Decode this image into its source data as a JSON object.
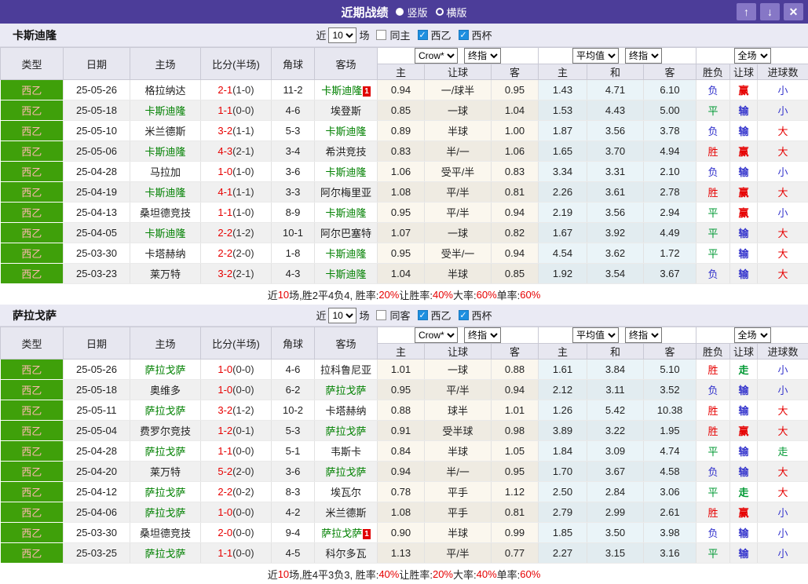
{
  "title_bar": {
    "title": "近期战绩",
    "radio_vertical": "竖版",
    "radio_horizontal": "横版",
    "up_button": "↑",
    "down_button": "↓",
    "close_button": "✕"
  },
  "controls": {
    "recent_label": "近",
    "matches_label": "场"
  },
  "selects": {
    "recent_count": "10",
    "odds_source": "Crow*",
    "final_odds": "终指",
    "average": "平均值",
    "scope": "全场"
  },
  "headers": {
    "type": "类型",
    "date": "日期",
    "home": "主场",
    "score": "比分(半场)",
    "corner": "角球",
    "away": "客场",
    "odds_home": "主",
    "odds_handicap": "让球",
    "odds_away": "客",
    "avg_home": "主",
    "avg_draw": "和",
    "avg_away": "客",
    "win_loss": "胜负",
    "handicap": "让球",
    "goals": "进球数"
  },
  "colors": {
    "titlebar_purple": "#4C3D99",
    "button_purple": "#8677C6",
    "league_green_bg": "#3FA00A",
    "self_team_green": "#008000",
    "score_red": "#E60000",
    "result_red": "#E60000",
    "result_blue": "#3333CC",
    "result_green": "#009933",
    "checkbox_blue": "#1E8FE0"
  },
  "sections": [
    {
      "team": "卡斯迪隆",
      "same_side_label": "同主",
      "same_side_checked": false,
      "league_label": "西乙",
      "league_checked": true,
      "cup_label": "西杯",
      "cup_checked": true,
      "rows": [
        {
          "league": "西乙",
          "date": "25-05-26",
          "home": "格拉纳达",
          "home_self": false,
          "home_badge": "",
          "score": "2-1",
          "half": "(1-0)",
          "corner": "11-2",
          "away": "卡斯迪隆",
          "away_self": true,
          "away_badge": "1",
          "odds_home": "0.94",
          "handicap": "一/球半",
          "odds_away": "0.95",
          "avg_home": "1.43",
          "avg_draw": "4.71",
          "avg_away": "6.10",
          "result": "负",
          "result_color": "blue",
          "handicap_result": "赢",
          "handicap_color": "red",
          "goals": "小",
          "goals_color": "blue"
        },
        {
          "league": "西乙",
          "date": "25-05-18",
          "home": "卡斯迪隆",
          "home_self": true,
          "home_badge": "",
          "score": "1-1",
          "half": "(0-0)",
          "corner": "4-6",
          "away": "埃登斯",
          "away_self": false,
          "away_badge": "",
          "odds_home": "0.85",
          "handicap": "一球",
          "odds_away": "1.04",
          "avg_home": "1.53",
          "avg_draw": "4.43",
          "avg_away": "5.00",
          "result": "平",
          "result_color": "green",
          "handicap_result": "输",
          "handicap_color": "blue",
          "goals": "小",
          "goals_color": "blue"
        },
        {
          "league": "西乙",
          "date": "25-05-10",
          "home": "米兰德斯",
          "home_self": false,
          "home_badge": "",
          "score": "3-2",
          "half": "(1-1)",
          "corner": "5-3",
          "away": "卡斯迪隆",
          "away_self": true,
          "away_badge": "",
          "odds_home": "0.89",
          "handicap": "半球",
          "odds_away": "1.00",
          "avg_home": "1.87",
          "avg_draw": "3.56",
          "avg_away": "3.78",
          "result": "负",
          "result_color": "blue",
          "handicap_result": "输",
          "handicap_color": "blue",
          "goals": "大",
          "goals_color": "red"
        },
        {
          "league": "西乙",
          "date": "25-05-06",
          "home": "卡斯迪隆",
          "home_self": true,
          "home_badge": "",
          "score": "4-3",
          "half": "(2-1)",
          "corner": "3-4",
          "away": "希洪竞技",
          "away_self": false,
          "away_badge": "",
          "odds_home": "0.83",
          "handicap": "半/一",
          "odds_away": "1.06",
          "avg_home": "1.65",
          "avg_draw": "3.70",
          "avg_away": "4.94",
          "result": "胜",
          "result_color": "red",
          "handicap_result": "赢",
          "handicap_color": "red",
          "goals": "大",
          "goals_color": "red"
        },
        {
          "league": "西乙",
          "date": "25-04-28",
          "home": "马拉加",
          "home_self": false,
          "home_badge": "",
          "score": "1-0",
          "half": "(1-0)",
          "corner": "3-6",
          "away": "卡斯迪隆",
          "away_self": true,
          "away_badge": "",
          "odds_home": "1.06",
          "handicap": "受平/半",
          "odds_away": "0.83",
          "avg_home": "3.34",
          "avg_draw": "3.31",
          "avg_away": "2.10",
          "result": "负",
          "result_color": "blue",
          "handicap_result": "输",
          "handicap_color": "blue",
          "goals": "小",
          "goals_color": "blue"
        },
        {
          "league": "西乙",
          "date": "25-04-19",
          "home": "卡斯迪隆",
          "home_self": true,
          "home_badge": "",
          "score": "4-1",
          "half": "(1-1)",
          "corner": "3-3",
          "away": "阿尔梅里亚",
          "away_self": false,
          "away_badge": "",
          "odds_home": "1.08",
          "handicap": "平/半",
          "odds_away": "0.81",
          "avg_home": "2.26",
          "avg_draw": "3.61",
          "avg_away": "2.78",
          "result": "胜",
          "result_color": "red",
          "handicap_result": "赢",
          "handicap_color": "red",
          "goals": "大",
          "goals_color": "red"
        },
        {
          "league": "西乙",
          "date": "25-04-13",
          "home": "桑坦德竞技",
          "home_self": false,
          "home_badge": "",
          "score": "1-1",
          "half": "(1-0)",
          "corner": "8-9",
          "away": "卡斯迪隆",
          "away_self": true,
          "away_badge": "",
          "odds_home": "0.95",
          "handicap": "平/半",
          "odds_away": "0.94",
          "avg_home": "2.19",
          "avg_draw": "3.56",
          "avg_away": "2.94",
          "result": "平",
          "result_color": "green",
          "handicap_result": "赢",
          "handicap_color": "red",
          "goals": "小",
          "goals_color": "blue"
        },
        {
          "league": "西乙",
          "date": "25-04-05",
          "home": "卡斯迪隆",
          "home_self": true,
          "home_badge": "",
          "score": "2-2",
          "half": "(1-2)",
          "corner": "10-1",
          "away": "阿尔巴塞特",
          "away_self": false,
          "away_badge": "",
          "odds_home": "1.07",
          "handicap": "一球",
          "odds_away": "0.82",
          "avg_home": "1.67",
          "avg_draw": "3.92",
          "avg_away": "4.49",
          "result": "平",
          "result_color": "green",
          "handicap_result": "输",
          "handicap_color": "blue",
          "goals": "大",
          "goals_color": "red"
        },
        {
          "league": "西乙",
          "date": "25-03-30",
          "home": "卡塔赫纳",
          "home_self": false,
          "home_badge": "",
          "score": "2-2",
          "half": "(2-0)",
          "corner": "1-8",
          "away": "卡斯迪隆",
          "away_self": true,
          "away_badge": "",
          "odds_home": "0.95",
          "handicap": "受半/一",
          "odds_away": "0.94",
          "avg_home": "4.54",
          "avg_draw": "3.62",
          "avg_away": "1.72",
          "result": "平",
          "result_color": "green",
          "handicap_result": "输",
          "handicap_color": "blue",
          "goals": "大",
          "goals_color": "red"
        },
        {
          "league": "西乙",
          "date": "25-03-23",
          "home": "莱万特",
          "home_self": false,
          "home_badge": "",
          "score": "3-2",
          "half": "(2-1)",
          "corner": "4-3",
          "away": "卡斯迪隆",
          "away_self": true,
          "away_badge": "",
          "odds_home": "1.04",
          "handicap": "半球",
          "odds_away": "0.85",
          "avg_home": "1.92",
          "avg_draw": "3.54",
          "avg_away": "3.67",
          "result": "负",
          "result_color": "blue",
          "handicap_result": "输",
          "handicap_color": "blue",
          "goals": "大",
          "goals_color": "red"
        }
      ],
      "summary": [
        {
          "text": "近",
          "color": "black"
        },
        {
          "text": "10",
          "color": "red"
        },
        {
          "text": "场,胜2平4负4, 胜率:",
          "color": "black"
        },
        {
          "text": "20%",
          "color": "red"
        },
        {
          "text": " 让胜率:",
          "color": "black"
        },
        {
          "text": "40%",
          "color": "red"
        },
        {
          "text": " 大率:",
          "color": "black"
        },
        {
          "text": "60%",
          "color": "red"
        },
        {
          "text": " 单率:",
          "color": "black"
        },
        {
          "text": "60%",
          "color": "red"
        }
      ]
    },
    {
      "team": "萨拉戈萨",
      "same_side_label": "同客",
      "same_side_checked": false,
      "league_label": "西乙",
      "league_checked": true,
      "cup_label": "西杯",
      "cup_checked": true,
      "rows": [
        {
          "league": "西乙",
          "date": "25-05-26",
          "home": "萨拉戈萨",
          "home_self": true,
          "home_badge": "",
          "score": "1-0",
          "half": "(0-0)",
          "corner": "4-6",
          "away": "拉科鲁尼亚",
          "away_self": false,
          "away_badge": "",
          "odds_home": "1.01",
          "handicap": "一球",
          "odds_away": "0.88",
          "avg_home": "1.61",
          "avg_draw": "3.84",
          "avg_away": "5.10",
          "result": "胜",
          "result_color": "red",
          "handicap_result": "走",
          "handicap_color": "green",
          "goals": "小",
          "goals_color": "blue"
        },
        {
          "league": "西乙",
          "date": "25-05-18",
          "home": "奥维多",
          "home_self": false,
          "home_badge": "",
          "score": "1-0",
          "half": "(0-0)",
          "corner": "6-2",
          "away": "萨拉戈萨",
          "away_self": true,
          "away_badge": "",
          "odds_home": "0.95",
          "handicap": "平/半",
          "odds_away": "0.94",
          "avg_home": "2.12",
          "avg_draw": "3.11",
          "avg_away": "3.52",
          "result": "负",
          "result_color": "blue",
          "handicap_result": "输",
          "handicap_color": "blue",
          "goals": "小",
          "goals_color": "blue"
        },
        {
          "league": "西乙",
          "date": "25-05-11",
          "home": "萨拉戈萨",
          "home_self": true,
          "home_badge": "",
          "score": "3-2",
          "half": "(1-2)",
          "corner": "10-2",
          "away": "卡塔赫纳",
          "away_self": false,
          "away_badge": "",
          "odds_home": "0.88",
          "handicap": "球半",
          "odds_away": "1.01",
          "avg_home": "1.26",
          "avg_draw": "5.42",
          "avg_away": "10.38",
          "result": "胜",
          "result_color": "red",
          "handicap_result": "输",
          "handicap_color": "blue",
          "goals": "大",
          "goals_color": "red"
        },
        {
          "league": "西乙",
          "date": "25-05-04",
          "home": "费罗尔竞技",
          "home_self": false,
          "home_badge": "",
          "score": "1-2",
          "half": "(0-1)",
          "corner": "5-3",
          "away": "萨拉戈萨",
          "away_self": true,
          "away_badge": "",
          "odds_home": "0.91",
          "handicap": "受半球",
          "odds_away": "0.98",
          "avg_home": "3.89",
          "avg_draw": "3.22",
          "avg_away": "1.95",
          "result": "胜",
          "result_color": "red",
          "handicap_result": "赢",
          "handicap_color": "red",
          "goals": "大",
          "goals_color": "red"
        },
        {
          "league": "西乙",
          "date": "25-04-28",
          "home": "萨拉戈萨",
          "home_self": true,
          "home_badge": "",
          "score": "1-1",
          "half": "(0-0)",
          "corner": "5-1",
          "away": "韦斯卡",
          "away_self": false,
          "away_badge": "",
          "odds_home": "0.84",
          "handicap": "半球",
          "odds_away": "1.05",
          "avg_home": "1.84",
          "avg_draw": "3.09",
          "avg_away": "4.74",
          "result": "平",
          "result_color": "green",
          "handicap_result": "输",
          "handicap_color": "blue",
          "goals": "走",
          "goals_color": "green"
        },
        {
          "league": "西乙",
          "date": "25-04-20",
          "home": "莱万特",
          "home_self": false,
          "home_badge": "",
          "score": "5-2",
          "half": "(2-0)",
          "corner": "3-6",
          "away": "萨拉戈萨",
          "away_self": true,
          "away_badge": "",
          "odds_home": "0.94",
          "handicap": "半/一",
          "odds_away": "0.95",
          "avg_home": "1.70",
          "avg_draw": "3.67",
          "avg_away": "4.58",
          "result": "负",
          "result_color": "blue",
          "handicap_result": "输",
          "handicap_color": "blue",
          "goals": "大",
          "goals_color": "red"
        },
        {
          "league": "西乙",
          "date": "25-04-12",
          "home": "萨拉戈萨",
          "home_self": true,
          "home_badge": "",
          "score": "2-2",
          "half": "(0-2)",
          "corner": "8-3",
          "away": "埃瓦尔",
          "away_self": false,
          "away_badge": "",
          "odds_home": "0.78",
          "handicap": "平手",
          "odds_away": "1.12",
          "avg_home": "2.50",
          "avg_draw": "2.84",
          "avg_away": "3.06",
          "result": "平",
          "result_color": "green",
          "handicap_result": "走",
          "handicap_color": "green",
          "goals": "大",
          "goals_color": "red"
        },
        {
          "league": "西乙",
          "date": "25-04-06",
          "home": "萨拉戈萨",
          "home_self": true,
          "home_badge": "",
          "score": "1-0",
          "half": "(0-0)",
          "corner": "4-2",
          "away": "米兰德斯",
          "away_self": false,
          "away_badge": "",
          "odds_home": "1.08",
          "handicap": "平手",
          "odds_away": "0.81",
          "avg_home": "2.79",
          "avg_draw": "2.99",
          "avg_away": "2.61",
          "result": "胜",
          "result_color": "red",
          "handicap_result": "赢",
          "handicap_color": "red",
          "goals": "小",
          "goals_color": "blue"
        },
        {
          "league": "西乙",
          "date": "25-03-30",
          "home": "桑坦德竞技",
          "home_self": false,
          "home_badge": "",
          "score": "2-0",
          "half": "(0-0)",
          "corner": "9-4",
          "away": "萨拉戈萨",
          "away_self": true,
          "away_badge": "1",
          "odds_home": "0.90",
          "handicap": "半球",
          "odds_away": "0.99",
          "avg_home": "1.85",
          "avg_draw": "3.50",
          "avg_away": "3.98",
          "result": "负",
          "result_color": "blue",
          "handicap_result": "输",
          "handicap_color": "blue",
          "goals": "小",
          "goals_color": "blue"
        },
        {
          "league": "西乙",
          "date": "25-03-25",
          "home": "萨拉戈萨",
          "home_self": true,
          "home_badge": "",
          "score": "1-1",
          "half": "(0-0)",
          "corner": "4-5",
          "away": "科尔多瓦",
          "away_self": false,
          "away_badge": "",
          "odds_home": "1.13",
          "handicap": "平/半",
          "odds_away": "0.77",
          "avg_home": "2.27",
          "avg_draw": "3.15",
          "avg_away": "3.16",
          "result": "平",
          "result_color": "green",
          "handicap_result": "输",
          "handicap_color": "blue",
          "goals": "小",
          "goals_color": "blue"
        }
      ],
      "summary": [
        {
          "text": "近",
          "color": "black"
        },
        {
          "text": "10",
          "color": "red"
        },
        {
          "text": "场,胜4平3负3, 胜率:",
          "color": "black"
        },
        {
          "text": "40%",
          "color": "red"
        },
        {
          "text": " 让胜率:",
          "color": "black"
        },
        {
          "text": "20%",
          "color": "red"
        },
        {
          "text": " 大率:",
          "color": "black"
        },
        {
          "text": "40%",
          "color": "red"
        },
        {
          "text": " 单率:",
          "color": "black"
        },
        {
          "text": "60%",
          "color": "red"
        }
      ]
    }
  ]
}
